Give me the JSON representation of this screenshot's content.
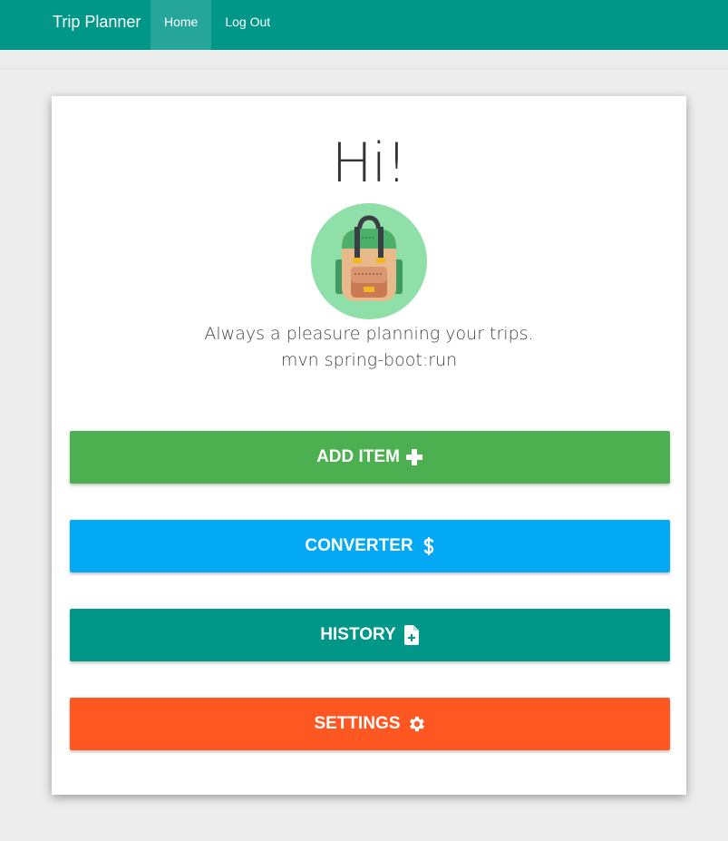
{
  "navbar": {
    "brand": "Trip Planner",
    "items": [
      {
        "label": "Home",
        "active": true
      },
      {
        "label": "Log Out",
        "active": false
      }
    ],
    "color": "#009688"
  },
  "card": {
    "greeting": "Hi!",
    "avatar_icon": "backpack-icon",
    "tagline": "Always a pleasure planning your trips.",
    "subline": "mvn spring-boot:run"
  },
  "buttons": [
    {
      "label": "ADD ITEM",
      "icon": "plus-icon",
      "color": "#4caf50"
    },
    {
      "label": "CONVERTER",
      "icon": "dollar-icon",
      "color": "#03a9f4"
    },
    {
      "label": "HISTORY",
      "icon": "file-add-icon",
      "color": "#009688"
    },
    {
      "label": "SETTINGS",
      "icon": "gear-icon",
      "color": "#ff5722"
    }
  ]
}
